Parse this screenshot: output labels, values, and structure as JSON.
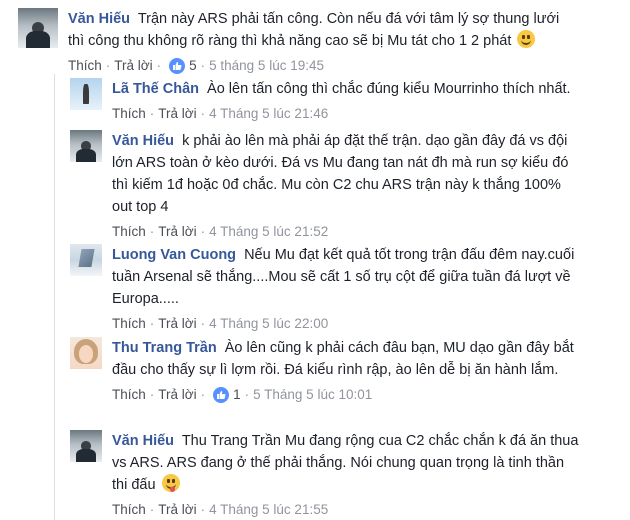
{
  "comments": [
    {
      "name": "Văn Hiếu",
      "text": "Trận này ARS phải tấn công. Còn nếu đá với tâm lý sợ thung lưới thì công thu không rõ ràng thì khả năng cao sẽ bị Mu tát cho 1 2 phát",
      "emoji": "smile-emoji",
      "like_label": "Thích",
      "reply_label": "Trả lời",
      "likes": "5",
      "timestamp": "5 tháng 5 lúc 19:45"
    },
    {
      "name": "Lã Thế Chân",
      "text": "Ào lên tấn công thì chắc đúng kiểu Mourrinho thích nhất.",
      "like_label": "Thích",
      "reply_label": "Trả lời",
      "timestamp": "4 Tháng 5 lúc 21:46"
    },
    {
      "name": "Văn Hiếu",
      "text": "k phải ào lên mà phải áp đặt thế trận. dạo gần đây đá vs đội lớn ARS toàn ở kèo dưới. Đá vs Mu đang tan nát đh mà run sợ kiểu đó thì kiếm 1đ hoặc 0đ chắc. Mu còn C2 chu ARS trận này k thắng 100% out top 4",
      "like_label": "Thích",
      "reply_label": "Trả lời",
      "timestamp": "4 Tháng 5 lúc 21:52"
    },
    {
      "name": "Luong Van Cuong",
      "text": "Nếu Mu đạt kết quả tốt trong trận đấu đêm nay.cuối tuần Arsenal sẽ thắng....Mou sẽ cất 1 số trụ cột để giữa tuần đá lượt về Europa.....",
      "like_label": "Thích",
      "reply_label": "Trả lời",
      "timestamp": "4 Tháng 5 lúc 22:00"
    },
    {
      "name": "Thu Trang Trần",
      "text": "Ào lên cũng k phải cách đâu bạn, MU dạo gần đây bắt đầu cho thấy sự lì lợm rồi. Đá kiểu rình rập, ào lên dễ bị ăn hành lắm.",
      "like_label": "Thích",
      "reply_label": "Trả lời",
      "likes": "1",
      "timestamp": "5 Tháng 5 lúc 10:01"
    },
    {
      "name": "Văn Hiếu",
      "text": "Thu Trang Trần Mu đang rộng cua C2 chắc chắn k đá ăn thua vs ARS. ARS đang ở thế phải thắng. Nói chung quan trọng là tinh thần thi đấu",
      "emoji": "tongue-emoji",
      "like_label": "Thích",
      "reply_label": "Trả lời",
      "timestamp": "4 Tháng 5 lúc 21:55"
    }
  ],
  "colors": {
    "name": "#365899",
    "meta": "#90949c",
    "like_badge": "#5890ff"
  }
}
